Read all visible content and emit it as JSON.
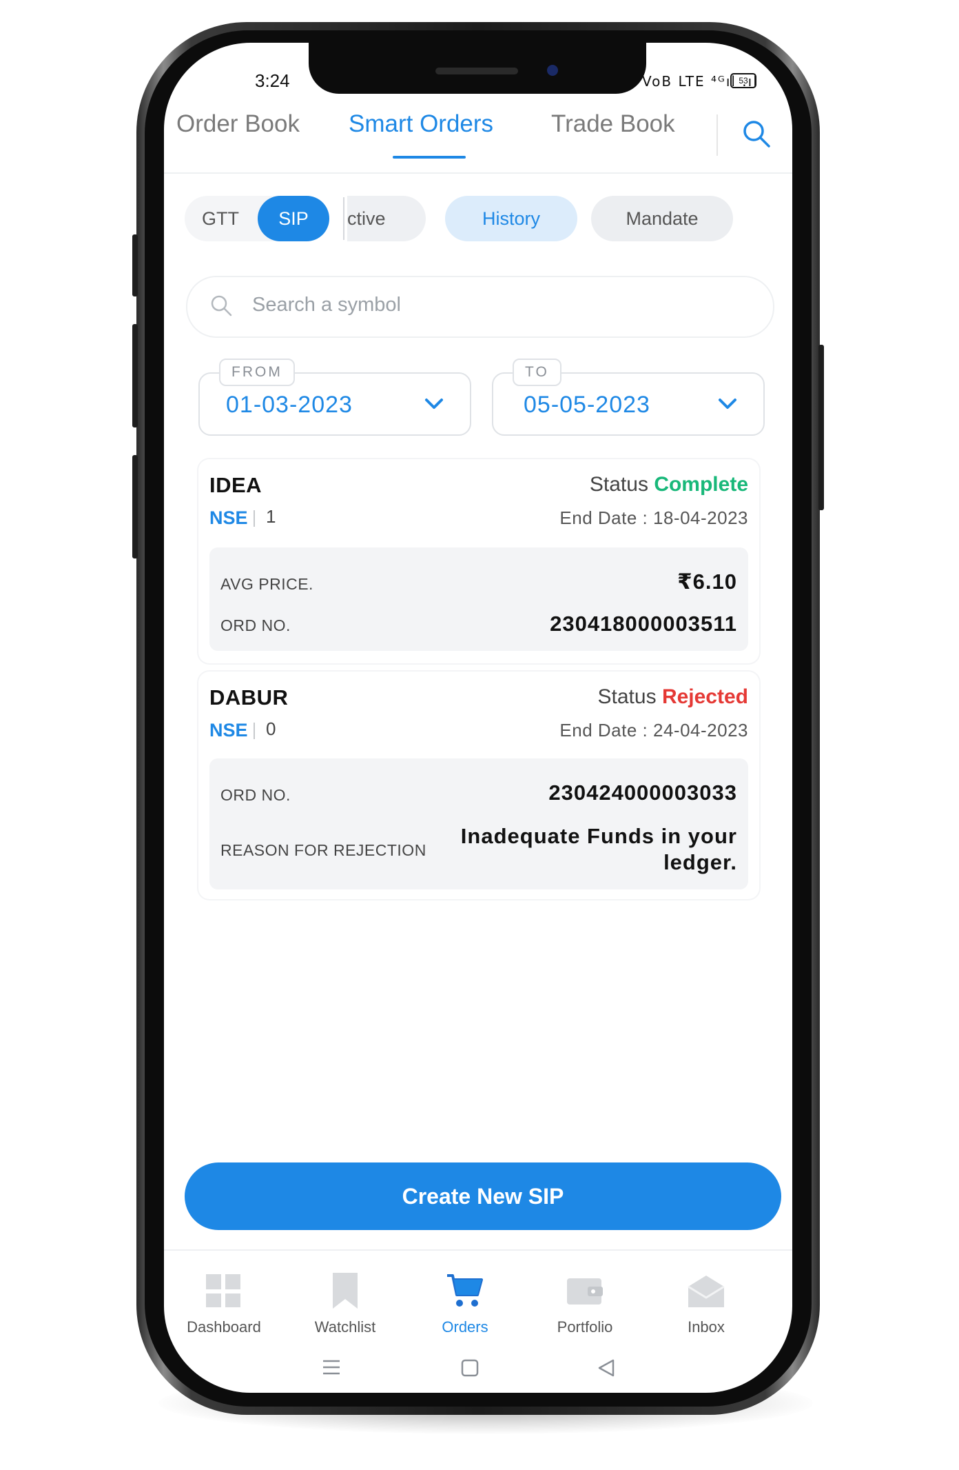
{
  "status_bar": {
    "time": "3:24",
    "signal": "VoB LTE ⁴ᴳıl .ıl",
    "battery": "53"
  },
  "top_tabs": [
    {
      "label": "Order Book",
      "active": false
    },
    {
      "label": "Smart Orders",
      "active": true
    },
    {
      "label": "Trade Book",
      "active": false
    }
  ],
  "filters": {
    "type_toggle": [
      {
        "label": "GTT",
        "selected": false
      },
      {
        "label": "SIP",
        "selected": true
      }
    ],
    "status_chips": [
      {
        "label": "ctive",
        "selected": false
      },
      {
        "label": "History",
        "selected": true
      },
      {
        "label": "Mandate",
        "selected": false
      }
    ]
  },
  "search": {
    "placeholder": "Search a symbol"
  },
  "date_range": {
    "from_label": "FROM",
    "from_value": "01-03-2023",
    "to_label": "TO",
    "to_value": "05-05-2023"
  },
  "orders": [
    {
      "symbol": "IDEA",
      "exchange": "NSE",
      "qty": "1",
      "status_label": "Status",
      "status": "Complete",
      "status_color": "#19b87a",
      "end_date": "End Date : 18-04-2023",
      "rows": [
        {
          "label": "AVG PRICE.",
          "value": "₹6.10"
        },
        {
          "label": "ORD NO.",
          "value": "230418000003511"
        }
      ]
    },
    {
      "symbol": "DABUR",
      "exchange": "NSE",
      "qty": "0",
      "status_label": "Status",
      "status": "Rejected",
      "status_color": "#e53935",
      "end_date": "End Date : 24-04-2023",
      "rows": [
        {
          "label": "ORD NO.",
          "value": "230424000003033"
        },
        {
          "label": "REASON FOR REJECTION",
          "value": "Inadequate Funds in your ledger."
        }
      ]
    }
  ],
  "create_button": {
    "label": "Create New SIP"
  },
  "bottom_nav": [
    {
      "label": "Dashboard",
      "icon": "dashboard-icon",
      "active": false
    },
    {
      "label": "Watchlist",
      "icon": "bookmark-icon",
      "active": false
    },
    {
      "label": "Orders",
      "icon": "cart-icon",
      "active": true
    },
    {
      "label": "Portfolio",
      "icon": "wallet-icon",
      "active": false
    },
    {
      "label": "Inbox",
      "icon": "inbox-icon",
      "active": false
    }
  ],
  "colors": {
    "accent": "#1e88e5",
    "complete": "#19b87a",
    "rejected": "#e53935"
  }
}
